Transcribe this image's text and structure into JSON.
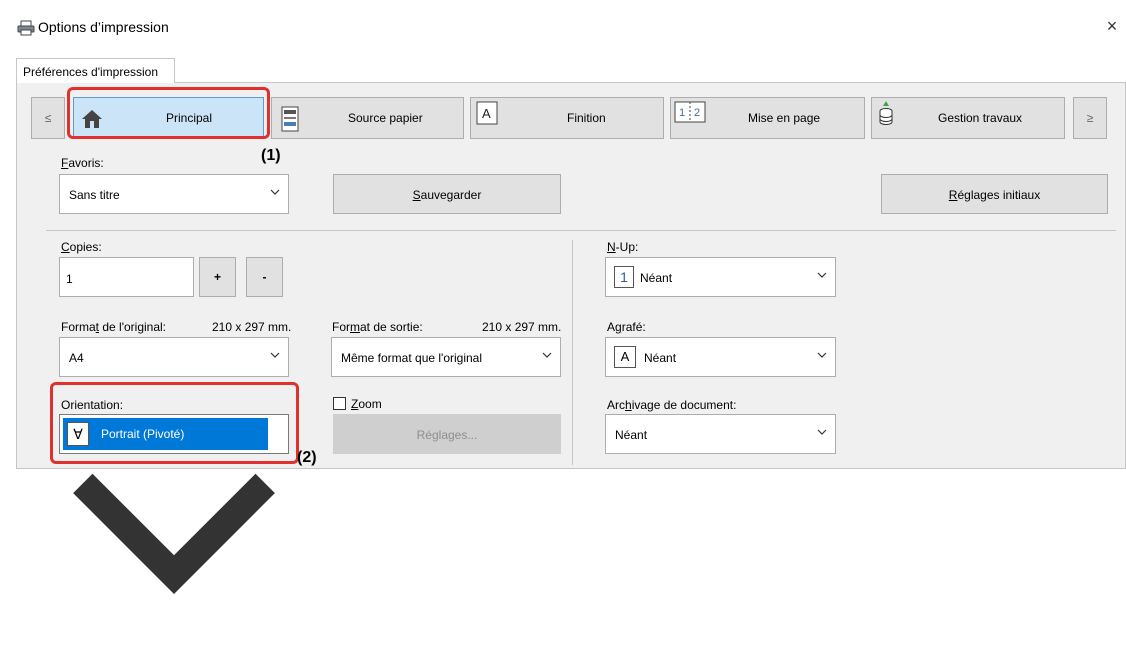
{
  "window": {
    "title": "Options d’impression",
    "close_glyph": "×"
  },
  "tabs": [
    {
      "label": "Préférences d'impression"
    }
  ],
  "nav": {
    "prev_glyph": "≤",
    "next_glyph": "≥",
    "items": [
      {
        "label": "Principal",
        "icon": "home-icon",
        "active": true
      },
      {
        "label": "Source papier",
        "icon": "paper-tray-icon",
        "active": false
      },
      {
        "label": "Finition",
        "icon": "finishing-icon",
        "active": false
      },
      {
        "label": "Mise en page",
        "icon": "layout-icon",
        "active": false
      },
      {
        "label": "Gestion travaux",
        "icon": "job-handling-icon",
        "active": false
      }
    ]
  },
  "callouts": {
    "one": "(1)",
    "two": "(2)"
  },
  "favoris": {
    "label": "Favoris:",
    "value": "Sans titre"
  },
  "buttons": {
    "save": "Sauvegarder",
    "defaults": "Réglages initiaux",
    "settings": "Réglages..."
  },
  "copies": {
    "label": "Copies:",
    "value": "1",
    "plus": "+",
    "minus": "-"
  },
  "original_size": {
    "label": "Format de l'original:",
    "dims": "210 x 297 mm.",
    "value": "A4"
  },
  "output_size": {
    "label": "Format de sortie:",
    "dims": "210 x 297 mm.",
    "value": "Même format que l'original"
  },
  "orientation": {
    "label": "Orientation:",
    "value": "Portrait (Pivoté)",
    "icon_glyph": "∀"
  },
  "zoom": {
    "label": "Zoom",
    "checked": false
  },
  "nup": {
    "label": "N-Up:",
    "value": "Néant",
    "icon_glyph": "1"
  },
  "staple": {
    "label": "Agrafé:",
    "value": "Néant",
    "icon_glyph": "A"
  },
  "archive": {
    "label": "Archivage de document:",
    "value": "Néant"
  },
  "colors": {
    "accent": "#0078d7",
    "highlight_red": "#e0312f",
    "active_tab": "#cce4f7",
    "panel_bg": "#f0f0f0"
  }
}
